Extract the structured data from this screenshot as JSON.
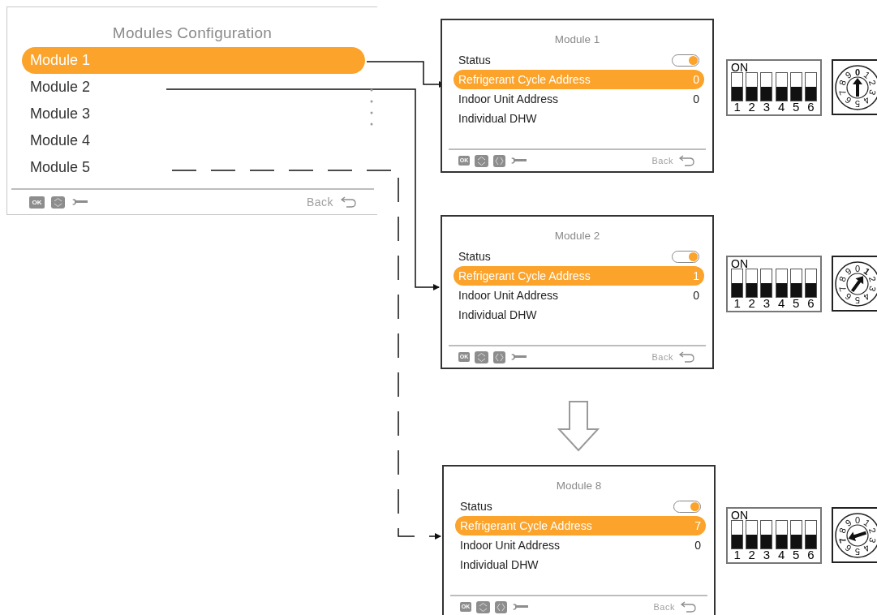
{
  "main_menu": {
    "title": "Modules Configuration",
    "items": [
      {
        "label": "Module 1",
        "selected": true
      },
      {
        "label": "Module 2",
        "selected": false
      },
      {
        "label": "Module 3",
        "selected": false
      },
      {
        "label": "Module 4",
        "selected": false
      },
      {
        "label": "Module 5",
        "selected": false
      }
    ],
    "footer": {
      "ok_label": "OK",
      "back_label": "Back",
      "has_left_right": false
    }
  },
  "modules": [
    {
      "title": "Module 1",
      "rows": [
        {
          "kind": "toggle",
          "label": "Status",
          "on": true,
          "selected": false
        },
        {
          "kind": "value",
          "label": "Refrigerant Cycle Address",
          "value": "0",
          "selected": true
        },
        {
          "kind": "value",
          "label": "Indoor Unit Address",
          "value": "0",
          "selected": false
        },
        {
          "kind": "value",
          "label": "Individual DHW",
          "selected": false
        }
      ],
      "footer": {
        "ok_label": "OK",
        "back_label": "Back",
        "has_left_right": true
      },
      "dip_switch": {
        "label": "ON",
        "switches": [
          {
            "label": "1",
            "on": false
          },
          {
            "label": "2",
            "on": false
          },
          {
            "label": "3",
            "on": false
          },
          {
            "label": "4",
            "on": false
          },
          {
            "label": "5",
            "on": false
          },
          {
            "label": "6",
            "on": false
          }
        ]
      },
      "rotary_dial": {
        "digits": [
          {
            "label": "0",
            "selected": true
          },
          {
            "label": "1",
            "selected": false
          },
          {
            "label": "2",
            "selected": false
          },
          {
            "label": "3",
            "selected": false
          },
          {
            "label": "4",
            "selected": false
          },
          {
            "label": "5",
            "selected": false
          },
          {
            "label": "6",
            "selected": false
          },
          {
            "label": "7",
            "selected": false
          },
          {
            "label": "8",
            "selected": false
          },
          {
            "label": "9",
            "selected": false
          }
        ]
      }
    },
    {
      "title": "Module 2",
      "rows": [
        {
          "kind": "toggle",
          "label": "Status",
          "on": true,
          "selected": false
        },
        {
          "kind": "value",
          "label": "Refrigerant Cycle Address",
          "value": "1",
          "selected": true
        },
        {
          "kind": "value",
          "label": "Indoor Unit Address",
          "value": "0",
          "selected": false
        },
        {
          "kind": "value",
          "label": "Individual DHW",
          "selected": false
        }
      ],
      "footer": {
        "ok_label": "OK",
        "back_label": "Back",
        "has_left_right": true
      },
      "dip_switch": {
        "label": "ON",
        "switches": [
          {
            "label": "1",
            "on": false
          },
          {
            "label": "2",
            "on": false
          },
          {
            "label": "3",
            "on": false
          },
          {
            "label": "4",
            "on": false
          },
          {
            "label": "5",
            "on": false
          },
          {
            "label": "6",
            "on": false
          }
        ]
      },
      "rotary_dial": {
        "digits": [
          {
            "label": "0",
            "selected": false
          },
          {
            "label": "1",
            "selected": true
          },
          {
            "label": "2",
            "selected": false
          },
          {
            "label": "3",
            "selected": false
          },
          {
            "label": "4",
            "selected": false
          },
          {
            "label": "5",
            "selected": false
          },
          {
            "label": "6",
            "selected": false
          },
          {
            "label": "7",
            "selected": false
          },
          {
            "label": "8",
            "selected": false
          },
          {
            "label": "9",
            "selected": false
          }
        ]
      }
    },
    {
      "title": "Module 8",
      "rows": [
        {
          "kind": "toggle",
          "label": "Status",
          "on": true,
          "selected": false
        },
        {
          "kind": "value",
          "label": "Refrigerant Cycle Address",
          "value": "7",
          "selected": true
        },
        {
          "kind": "value",
          "label": "Indoor Unit Address",
          "value": "0",
          "selected": false
        },
        {
          "kind": "value",
          "label": "Individual DHW",
          "selected": false
        }
      ],
      "footer": {
        "ok_label": "OK",
        "back_label": "Back",
        "has_left_right": true
      },
      "dip_switch": {
        "label": "ON",
        "switches": [
          {
            "label": "1",
            "on": false
          },
          {
            "label": "2",
            "on": false
          },
          {
            "label": "3",
            "on": false
          },
          {
            "label": "4",
            "on": false
          },
          {
            "label": "5",
            "on": false
          },
          {
            "label": "6",
            "on": false
          }
        ]
      },
      "rotary_dial": {
        "digits": [
          {
            "label": "0",
            "selected": false
          },
          {
            "label": "1",
            "selected": false
          },
          {
            "label": "2",
            "selected": false
          },
          {
            "label": "3",
            "selected": false
          },
          {
            "label": "4",
            "selected": false
          },
          {
            "label": "5",
            "selected": false
          },
          {
            "label": "6",
            "selected": false
          },
          {
            "label": "7",
            "selected": true
          },
          {
            "label": "8",
            "selected": false
          },
          {
            "label": "9",
            "selected": false
          }
        ]
      }
    }
  ]
}
